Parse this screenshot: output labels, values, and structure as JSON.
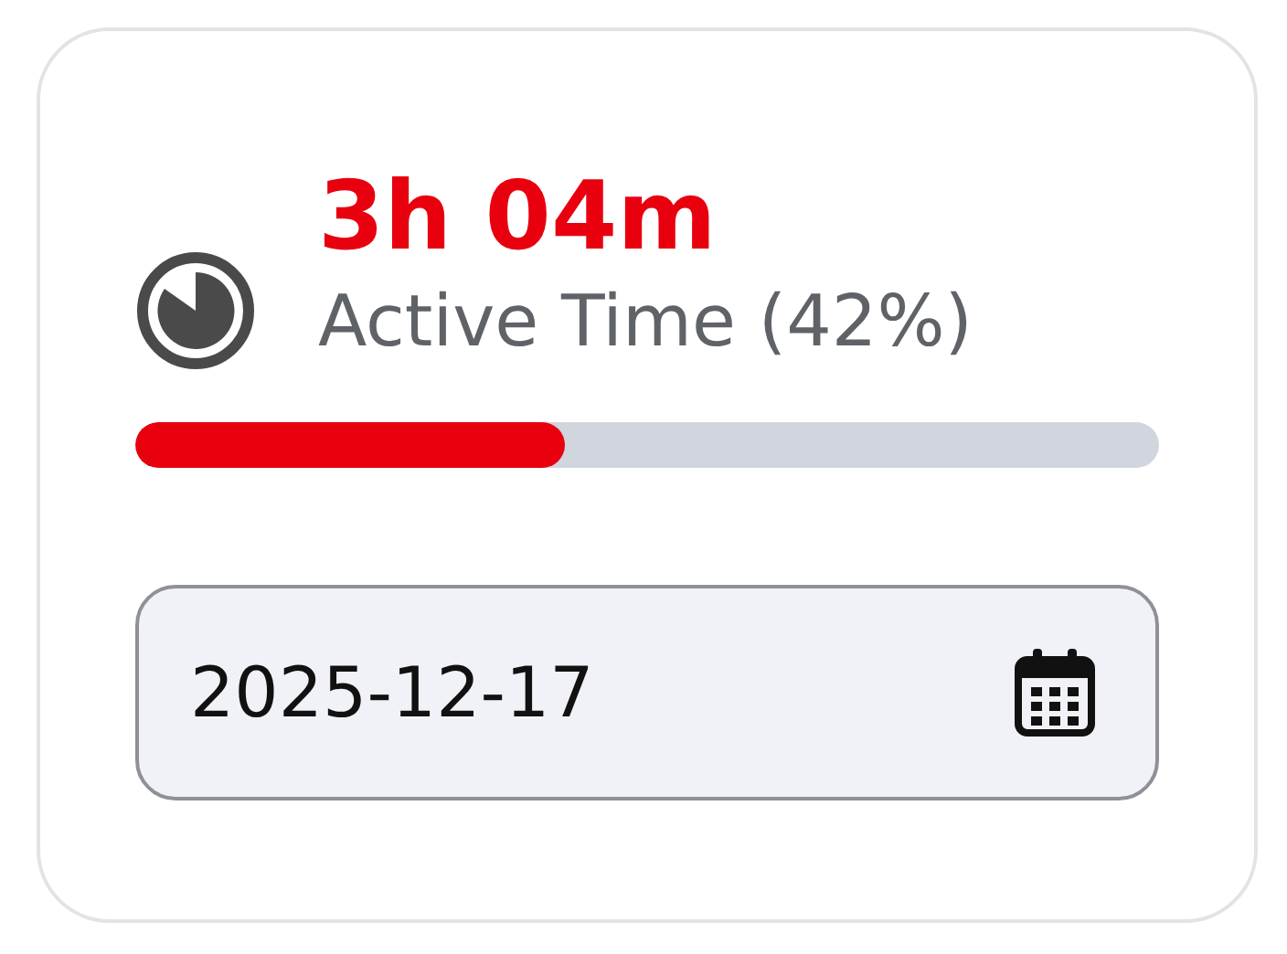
{
  "stat": {
    "value": "3h 04m",
    "label": "Active Time (42%)",
    "level": 0.42
  },
  "date_field": {
    "value": "2025-12-17"
  }
}
